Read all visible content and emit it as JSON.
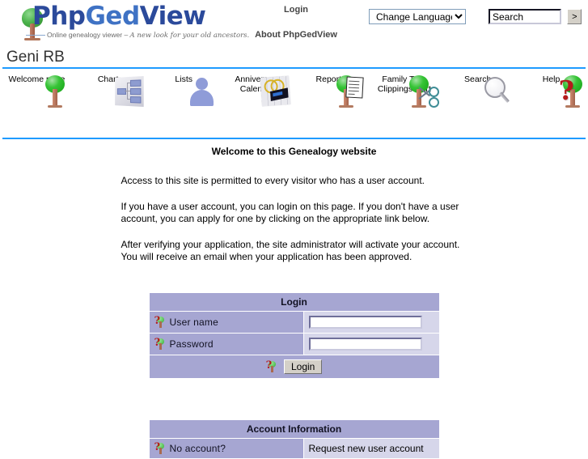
{
  "header": {
    "logo": {
      "text_php": "Php",
      "text_ged": "Ged",
      "text_view": "View",
      "tagline_plain": "Online genealogy viewer – ",
      "tagline_cursive": "A new look for your old ancestors."
    },
    "links": {
      "login": "Login",
      "about": "About PhpGedView"
    },
    "language_select": {
      "selected": "Change Language",
      "options": [
        "Change Language"
      ]
    },
    "search": {
      "value": "Search",
      "placeholder": "Search",
      "go_label": ">"
    }
  },
  "site_title": "Geni RB",
  "toolbar": {
    "items": [
      {
        "label": "Welcome page",
        "icon": "tree-icon"
      },
      {
        "label": "Charts",
        "icon": "chart-diagram-icon"
      },
      {
        "label": "Lists",
        "icon": "person-icon"
      },
      {
        "label": "Anniversary\nCalendar",
        "label_line1": "Anniversary",
        "label_line2": "Calendar",
        "icon": "calendar-icon"
      },
      {
        "label": "Reports",
        "icon": "tree-document-icon"
      },
      {
        "label": "Family Tree\nClippings Cart",
        "label_line1": "Family Tree",
        "label_line2": "Clippings Cart",
        "icon": "tree-scissors-icon"
      },
      {
        "label": "Search",
        "icon": "magnifier-icon"
      },
      {
        "label": "Help",
        "icon": "question-mark-icon"
      }
    ]
  },
  "main": {
    "heading": "Welcome to this Genealogy website",
    "paragraphs": [
      "Access to this site is permitted to every visitor who has a user account.",
      "If you have a user account, you can login on this page. If you don't have a user account, you can apply for one by clicking on the appropriate link below.",
      "After verifying your application, the site administrator will activate your account. You will receive an email when your application has been approved."
    ],
    "login_table": {
      "title": "Login",
      "username_label": "User name",
      "username_value": "",
      "password_label": "Password",
      "password_value": "",
      "submit_label": "Login"
    },
    "account_table": {
      "title": "Account Information",
      "row1_label": "No account?",
      "row1_link": "Request new user account"
    }
  },
  "colors": {
    "accent_blue": "#1E9BFF",
    "table_header": "#a6a6d2",
    "table_value": "#d6d6ea",
    "logo_blue": "#2b4a9b",
    "help_red": "#b51b1b"
  }
}
